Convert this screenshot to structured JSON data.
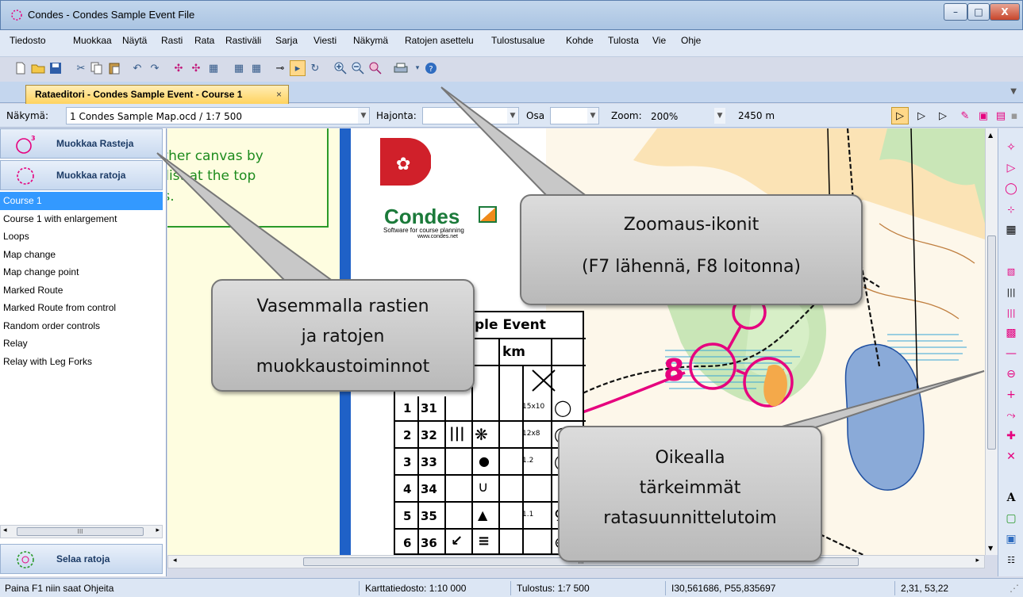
{
  "window": {
    "title": "Condes - Condes Sample Event File",
    "minimize_icon": "minimize-icon",
    "maximize_icon": "maximize-icon",
    "close_icon": "close-icon",
    "minimize_glyph": "–",
    "maximize_glyph": "□",
    "close_glyph": "X"
  },
  "menu": [
    "Tiedosto",
    "Muokkaa",
    "Näytä",
    "Rasti",
    "Rata",
    "Rastiväli",
    "Sarja",
    "Viesti",
    "Näkymä",
    "Ratojen asettelu",
    "Tulostusalue",
    "Kohde",
    "Tulosta",
    "Vie",
    "Ohje"
  ],
  "toolbar": {
    "icons": [
      "new-file-icon",
      "open-folder-icon",
      "save-icon",
      "cut-icon",
      "copy-icon",
      "paste-icon",
      "undo-icon",
      "redo-icon",
      "control-icon-1",
      "control-icon-2",
      "description-icon",
      "grid-icon-1",
      "grid-icon-2",
      "key-icon",
      "select-page-icon",
      "circle-rotate-icon",
      "zoom-in-icon",
      "zoom-out-icon",
      "zoom-fit-icon",
      "print-icon",
      "help-icon"
    ]
  },
  "tab": {
    "label": "Rataeditori - Condes Sample Event - Course 1",
    "close_glyph": "×"
  },
  "viewbar": {
    "view_label": "Näkymä:",
    "view_value": "1 Condes Sample Map.ocd  / 1:7 500",
    "spread_label": "Hajonta:",
    "spread_value": "",
    "part_label": "Osa",
    "part_value": "",
    "zoom_label": "Zoom:",
    "zoom_value": "200%",
    "length_value": "2450 m"
  },
  "left_panel": {
    "edit_controls_button": "Muokkaa Rasteja",
    "edit_controls_number": "31",
    "edit_courses_button": "Muokkaa ratoja",
    "browse_courses_button": "Selaa ratoja",
    "courses": [
      "Course 1",
      "Course 1 with enlargement",
      "Loops",
      "Map change",
      "Map change point",
      "Marked Route",
      "Marked Route from control",
      "Random order controls",
      "Relay",
      "Relay with Leg Forks"
    ],
    "selected_index": 0,
    "scroll_thumb": "III"
  },
  "canvas": {
    "yellow_text_lines": [
      "other canvas by",
      "\" list at the top",
      "as."
    ],
    "logo_name": "Condes",
    "logo_sub1": "Software for course planning",
    "logo_sub2": "www.condes.net",
    "event_title": "ple Event",
    "km_label": "km",
    "scroll_thumb": "III",
    "map_control_label": "8",
    "control_rows": [
      {
        "order": "1",
        "code": "31",
        "extra": "15x10"
      },
      {
        "order": "2",
        "code": "32",
        "extra": "12x8"
      },
      {
        "order": "3",
        "code": "33",
        "extra": "1.2"
      },
      {
        "order": "4",
        "code": "34",
        "extra": ""
      },
      {
        "order": "5",
        "code": "35",
        "extra": "1.1"
      },
      {
        "order": "6",
        "code": "36",
        "extra": ""
      }
    ]
  },
  "callouts": {
    "zoom": [
      "Zoomaus-ikonit",
      "(F7 lähennä, F8 loitonna)"
    ],
    "left": [
      "Vasemmalla rastien",
      "ja ratojen",
      "muokkaustoiminnot"
    ],
    "right": [
      "Oikealla",
      "tärkeimmät",
      "ratasuunnittelutoim"
    ]
  },
  "right_toolbar": {
    "icons": [
      "select-arrow-icon",
      "start-triangle-icon",
      "control-circle-icon",
      "finish-icon",
      "description-table-icon",
      "hatch-icon",
      "vertical-lines-icon",
      "pink-lines-icon",
      "pink-area-icon",
      "line-icon",
      "gate-icon",
      "crossing-point-icon",
      "forbidden-route-icon",
      "first-aid-icon",
      "cross-icon",
      "text-icon",
      "rectangle-icon",
      "image-icon",
      "legend-icon"
    ],
    "glyphs": [
      "▷",
      "◯",
      "⊹",
      "▦",
      "||",
      "|||",
      "▩",
      "—",
      "⊖",
      "+",
      "✚",
      "✕",
      "A",
      "▢",
      "▣"
    ],
    "colors": {
      "magenta": "#e6007e",
      "dark": "#333333",
      "blue": "#1f4fa0"
    }
  },
  "statusbar": {
    "help": "Paina F1 niin saat Ohjeita",
    "map_file": "Karttatiedosto: 1:10 000",
    "print": "Tulostus: 1:7 500",
    "coords": "I30,561686, P55,835697",
    "position": "2,31, 53,22"
  },
  "colors": {
    "accent": "#3399ff",
    "tab": "#ffd35f",
    "map_blue": "#1f61c7",
    "course_magenta": "#e6007e"
  }
}
